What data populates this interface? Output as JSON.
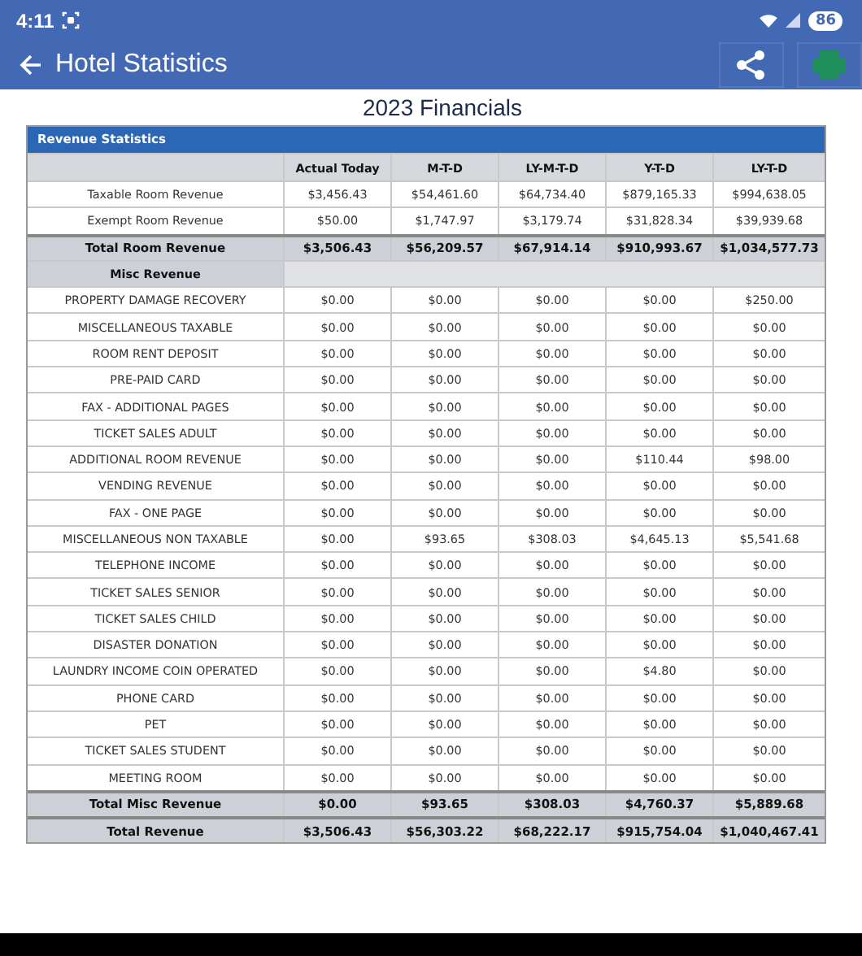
{
  "status_bar": {
    "time": "4:11",
    "battery": "86"
  },
  "app_bar": {
    "title": "Hotel Statistics"
  },
  "report_title": "2023 Financials",
  "table": {
    "caption": "Revenue Statistics",
    "columns": [
      "Actual Today",
      "M-T-D",
      "LY-M-T-D",
      "Y-T-D",
      "LY-T-D"
    ],
    "rows": [
      {
        "kind": "data",
        "label": "Taxable Room Revenue",
        "values": [
          "$3,456.43",
          "$54,461.60",
          "$64,734.40",
          "$879,165.33",
          "$994,638.05"
        ]
      },
      {
        "kind": "data",
        "label": "Exempt Room Revenue",
        "values": [
          "$50.00",
          "$1,747.97",
          "$3,179.74",
          "$31,828.34",
          "$39,939.68"
        ]
      },
      {
        "kind": "total",
        "label": "Total Room Revenue",
        "values": [
          "$3,506.43",
          "$56,209.57",
          "$67,914.14",
          "$910,993.67",
          "$1,034,577.73"
        ]
      },
      {
        "kind": "section",
        "label": "Misc Revenue",
        "values": []
      },
      {
        "kind": "data",
        "label": "PROPERTY DAMAGE RECOVERY",
        "values": [
          "$0.00",
          "$0.00",
          "$0.00",
          "$0.00",
          "$250.00"
        ]
      },
      {
        "kind": "data",
        "label": "MISCELLANEOUS TAXABLE",
        "values": [
          "$0.00",
          "$0.00",
          "$0.00",
          "$0.00",
          "$0.00"
        ]
      },
      {
        "kind": "data",
        "label": "ROOM RENT DEPOSIT",
        "values": [
          "$0.00",
          "$0.00",
          "$0.00",
          "$0.00",
          "$0.00"
        ]
      },
      {
        "kind": "data",
        "label": "PRE-PAID CARD",
        "values": [
          "$0.00",
          "$0.00",
          "$0.00",
          "$0.00",
          "$0.00"
        ]
      },
      {
        "kind": "data",
        "label": "FAX - ADDITIONAL PAGES",
        "values": [
          "$0.00",
          "$0.00",
          "$0.00",
          "$0.00",
          "$0.00"
        ]
      },
      {
        "kind": "data",
        "label": "TICKET SALES ADULT",
        "values": [
          "$0.00",
          "$0.00",
          "$0.00",
          "$0.00",
          "$0.00"
        ]
      },
      {
        "kind": "data",
        "label": "ADDITIONAL ROOM REVENUE",
        "values": [
          "$0.00",
          "$0.00",
          "$0.00",
          "$110.44",
          "$98.00"
        ]
      },
      {
        "kind": "data",
        "label": "VENDING REVENUE",
        "values": [
          "$0.00",
          "$0.00",
          "$0.00",
          "$0.00",
          "$0.00"
        ]
      },
      {
        "kind": "data",
        "label": "FAX - ONE PAGE",
        "values": [
          "$0.00",
          "$0.00",
          "$0.00",
          "$0.00",
          "$0.00"
        ]
      },
      {
        "kind": "data",
        "label": "MISCELLANEOUS NON TAXABLE",
        "values": [
          "$0.00",
          "$93.65",
          "$308.03",
          "$4,645.13",
          "$5,541.68"
        ]
      },
      {
        "kind": "data",
        "label": "TELEPHONE INCOME",
        "values": [
          "$0.00",
          "$0.00",
          "$0.00",
          "$0.00",
          "$0.00"
        ]
      },
      {
        "kind": "data",
        "label": "TICKET SALES SENIOR",
        "values": [
          "$0.00",
          "$0.00",
          "$0.00",
          "$0.00",
          "$0.00"
        ]
      },
      {
        "kind": "data",
        "label": "TICKET SALES CHILD",
        "values": [
          "$0.00",
          "$0.00",
          "$0.00",
          "$0.00",
          "$0.00"
        ]
      },
      {
        "kind": "data",
        "label": "DISASTER DONATION",
        "values": [
          "$0.00",
          "$0.00",
          "$0.00",
          "$0.00",
          "$0.00"
        ]
      },
      {
        "kind": "data",
        "label": "LAUNDRY INCOME COIN OPERATED",
        "values": [
          "$0.00",
          "$0.00",
          "$0.00",
          "$4.80",
          "$0.00"
        ]
      },
      {
        "kind": "data",
        "label": "PHONE CARD",
        "values": [
          "$0.00",
          "$0.00",
          "$0.00",
          "$0.00",
          "$0.00"
        ]
      },
      {
        "kind": "data",
        "label": "PET",
        "values": [
          "$0.00",
          "$0.00",
          "$0.00",
          "$0.00",
          "$0.00"
        ]
      },
      {
        "kind": "data",
        "label": "TICKET SALES STUDENT",
        "values": [
          "$0.00",
          "$0.00",
          "$0.00",
          "$0.00",
          "$0.00"
        ]
      },
      {
        "kind": "data",
        "label": "MEETING ROOM",
        "values": [
          "$0.00",
          "$0.00",
          "$0.00",
          "$0.00",
          "$0.00"
        ]
      },
      {
        "kind": "total",
        "label": "Total Misc Revenue",
        "values": [
          "$0.00",
          "$93.65",
          "$308.03",
          "$4,760.37",
          "$5,889.68"
        ]
      },
      {
        "kind": "total",
        "label": "Total Revenue",
        "values": [
          "$3,506.43",
          "$56,303.22",
          "$68,222.17",
          "$915,754.04",
          "$1,040,467.41"
        ]
      }
    ]
  }
}
